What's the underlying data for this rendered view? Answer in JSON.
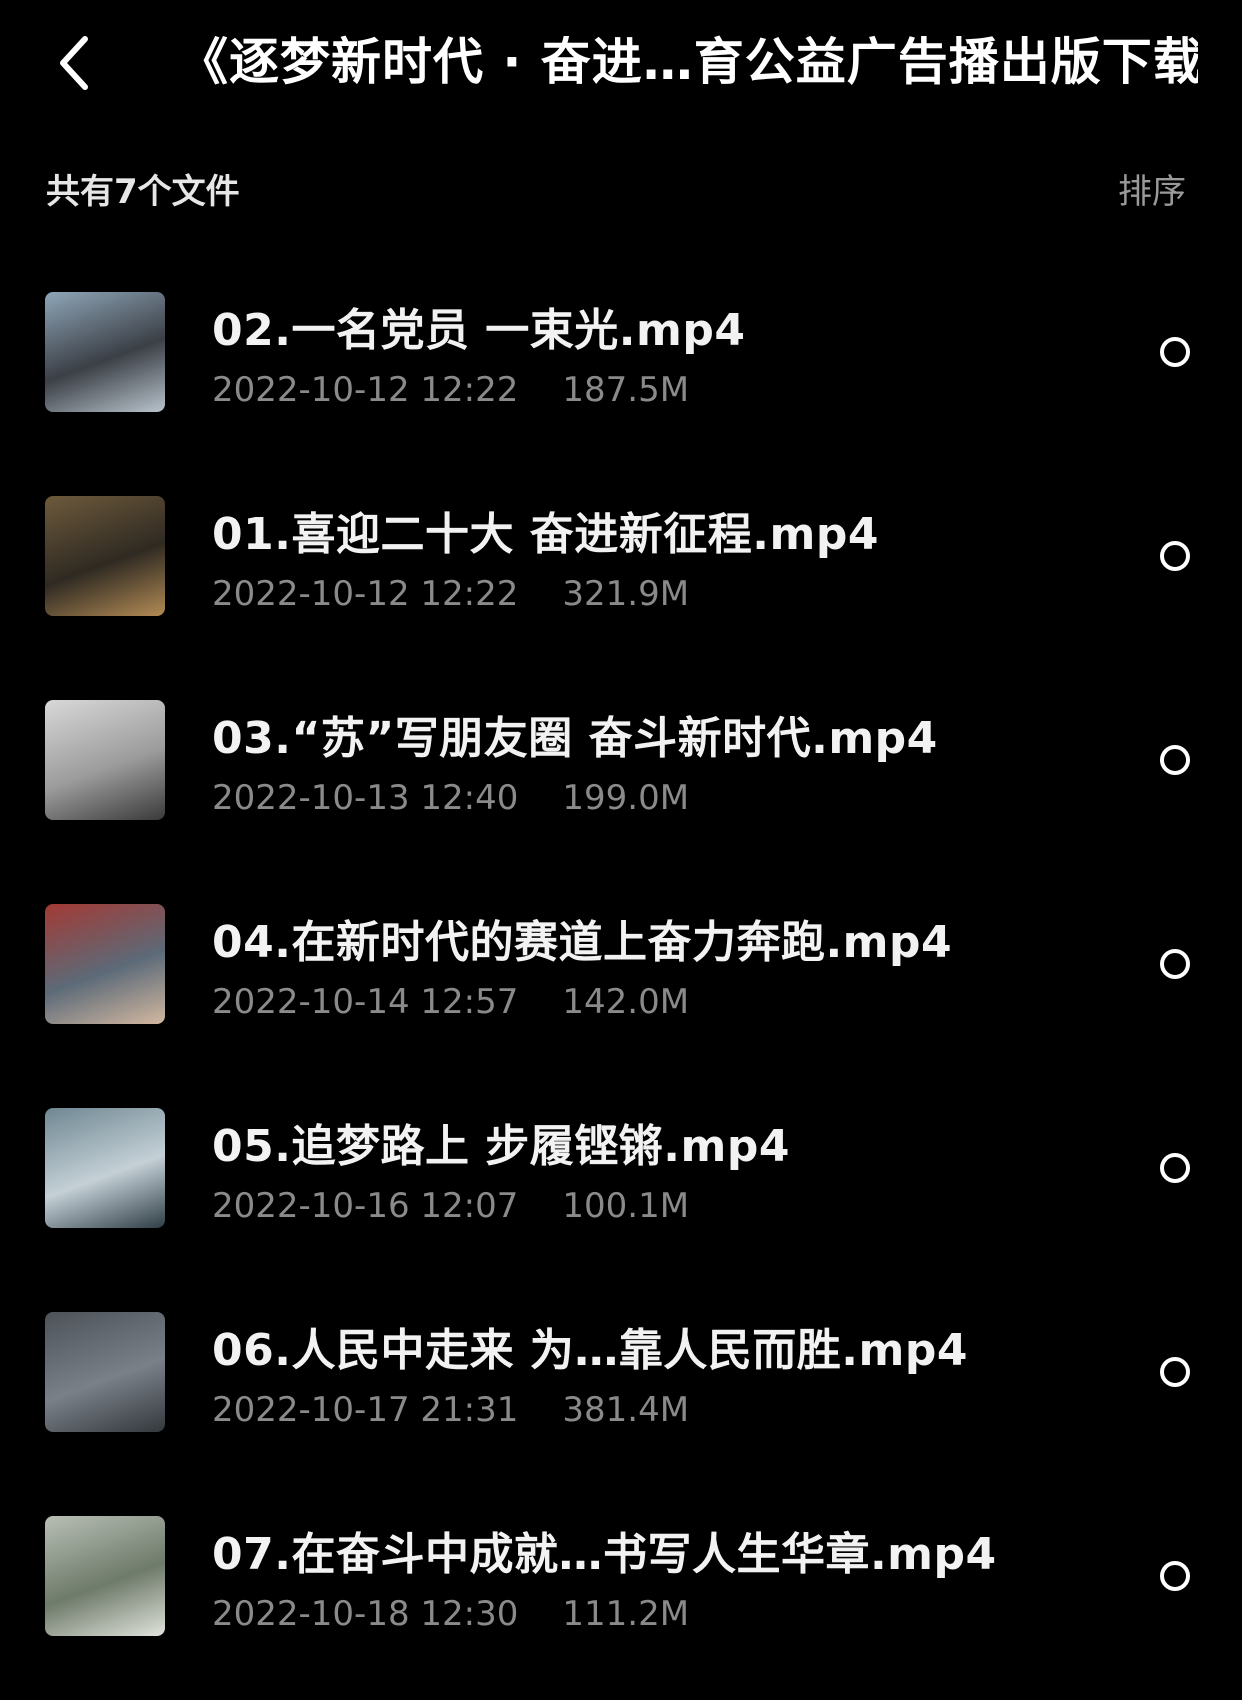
{
  "header": {
    "back_icon": "chevron-left-icon",
    "title": "《逐梦新时代 · 奋进…育公益广告播出版下载"
  },
  "subheader": {
    "file_count": "共有7个文件",
    "sort_label": "排序"
  },
  "files": [
    {
      "name": "02.一名党员 一束光.mp4",
      "date": "2022-10-12 12:22",
      "size": "187.5M",
      "thumb_colors": [
        "#8fa6b8",
        "#3b3f46",
        "#b9c4cc"
      ]
    },
    {
      "name": "01.喜迎二十大 奋进新征程.mp4",
      "date": "2022-10-12 12:22",
      "size": "321.9M",
      "thumb_colors": [
        "#6e5a3c",
        "#2f2a22",
        "#b38b55"
      ]
    },
    {
      "name": "03.“苏”写朋友圈 奋斗新时代.mp4",
      "date": "2022-10-13 12:40",
      "size": "199.0M",
      "thumb_colors": [
        "#d8d8d8",
        "#9c9c9c",
        "#3a3a3a"
      ]
    },
    {
      "name": "04.在新时代的赛道上奋力奔跑.mp4",
      "date": "2022-10-14 12:57",
      "size": "142.0M",
      "thumb_colors": [
        "#a33a34",
        "#5c6a78",
        "#d3b8a0"
      ]
    },
    {
      "name": "05.追梦路上 步履铿锵.mp4",
      "date": "2022-10-16 12:07",
      "size": "100.1M",
      "thumb_colors": [
        "#6f8792",
        "#c4d0d6",
        "#2f3d46"
      ]
    },
    {
      "name": "06.人民中走来 为…靠人民而胜.mp4",
      "date": "2022-10-17 21:31",
      "size": "381.4M",
      "thumb_colors": [
        "#4c5258",
        "#7a8088",
        "#33383d"
      ]
    },
    {
      "name": "07.在奋斗中成就…书写人生华章.mp4",
      "date": "2022-10-18 12:30",
      "size": "111.2M",
      "thumb_colors": [
        "#b8bfb5",
        "#6e7a6a",
        "#e0e3dc"
      ]
    }
  ]
}
